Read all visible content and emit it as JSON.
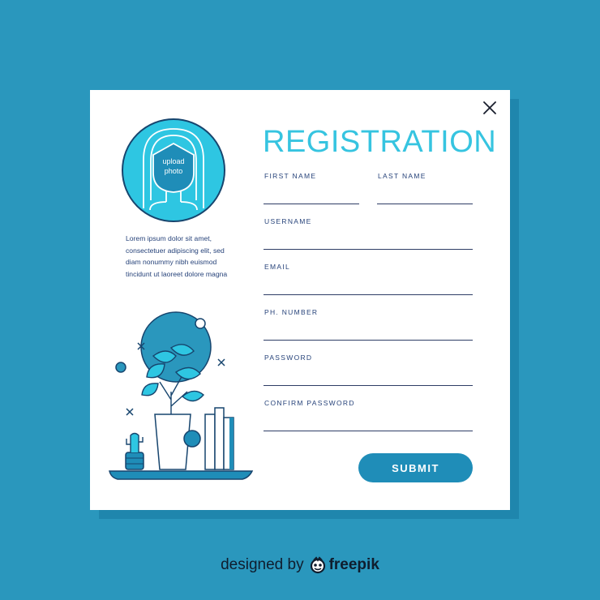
{
  "form": {
    "title": "REGISTRATION",
    "upload": {
      "line1": "upload",
      "line2": "photo"
    },
    "description": "Lorem ipsum dolor sit amet, consectetuer adipiscing elit, sed diam nonummy nibh euismod tincidunt ut laoreet dolore magna",
    "fields": {
      "first_name": {
        "label": "FIRST NAME",
        "value": ""
      },
      "last_name": {
        "label": "LAST NAME",
        "value": ""
      },
      "username": {
        "label": "USERNAME",
        "value": ""
      },
      "email": {
        "label": "EMAIL",
        "value": ""
      },
      "phone": {
        "label": "PH. NUMBER",
        "value": ""
      },
      "password": {
        "label": "PASSWORD",
        "value": ""
      },
      "confirm_password": {
        "label": "CONFIRM PASSWORD",
        "value": ""
      }
    },
    "submit_label": "SUBMIT"
  },
  "credit": {
    "prefix": "designed by",
    "brand": "freepik"
  },
  "colors": {
    "background": "#2a97bd",
    "card": "#ffffff",
    "title": "#36c4e0",
    "label_text": "#27437a",
    "accent": "#1f8db8",
    "avatar_fill": "#2ec6e2"
  },
  "icons": {
    "close": "close-icon",
    "avatar": "avatar-placeholder-icon",
    "logo": "freepik-logo-icon"
  }
}
